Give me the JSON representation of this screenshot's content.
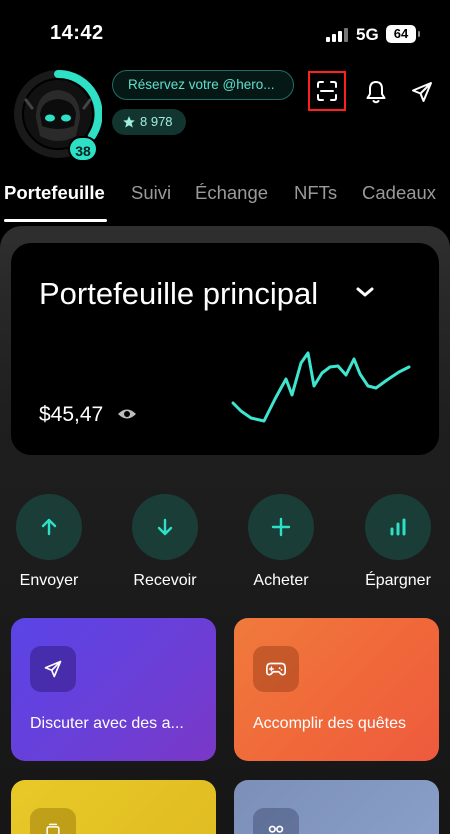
{
  "status_bar": {
    "time": "14:42",
    "network": "5G",
    "battery": "64"
  },
  "header": {
    "level": "38",
    "reserve_text": "Réservez votre @hero...",
    "points": "8 978"
  },
  "tabs": [
    "Portefeuille",
    "Suivi",
    "Échange",
    "NFTs",
    "Cadeaux"
  ],
  "active_tab": "Portefeuille",
  "wallet": {
    "title": "Portefeuille principal",
    "balance": "$45,47"
  },
  "actions": [
    {
      "label": "Envoyer",
      "icon": "arrow-up-icon"
    },
    {
      "label": "Recevoir",
      "icon": "arrow-down-icon"
    },
    {
      "label": "Acheter",
      "icon": "plus-icon"
    },
    {
      "label": "Épargner",
      "icon": "bar-chart-icon"
    }
  ],
  "features": [
    {
      "label": "Discuter avec des a...",
      "icon": "send-icon"
    },
    {
      "label": "Accomplir des quêtes",
      "icon": "gamepad-icon"
    },
    {
      "label": "",
      "icon": "cards-icon"
    },
    {
      "label": "",
      "icon": "users-icon"
    }
  ],
  "colors": {
    "accent": "#2de0c6",
    "action_circle": "#1b3d38",
    "chart_line": "#3ee6cf",
    "card_purple_start": "#5a44e6",
    "card_orange_start": "#f07a3c",
    "highlight_border": "#ff1f1f"
  }
}
